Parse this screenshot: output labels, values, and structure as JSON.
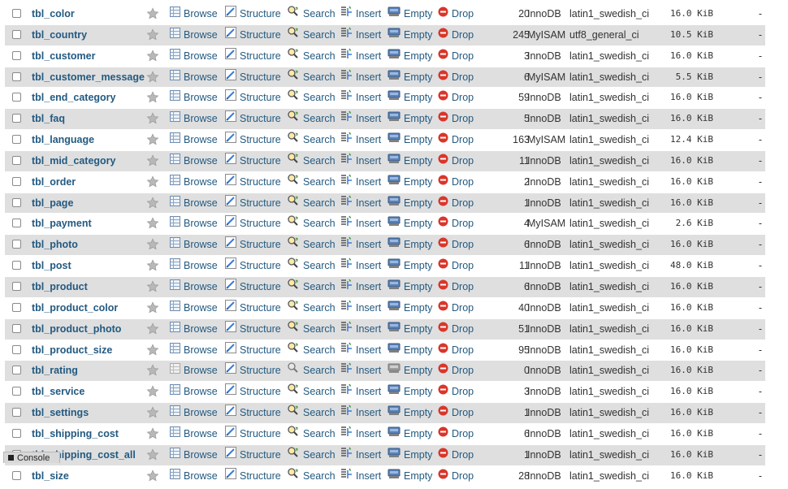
{
  "actions": {
    "browse": "Browse",
    "structure": "Structure",
    "search": "Search",
    "insert": "Insert",
    "empty": "Empty",
    "drop": "Drop"
  },
  "overhead_placeholder": "-",
  "console_label": "Console",
  "colors": {
    "link": "#235a81",
    "row_alt": "#dfdfdf",
    "drop_red": "#d9362b"
  },
  "tables": [
    {
      "name": "tbl_color",
      "rows": "20",
      "engine": "InnoDB",
      "collation": "latin1_swedish_ci",
      "size": "16.0 KiB"
    },
    {
      "name": "tbl_country",
      "rows": "245",
      "engine": "MyISAM",
      "collation": "utf8_general_ci",
      "size": "10.5 KiB"
    },
    {
      "name": "tbl_customer",
      "rows": "3",
      "engine": "InnoDB",
      "collation": "latin1_swedish_ci",
      "size": "16.0 KiB"
    },
    {
      "name": "tbl_customer_message",
      "rows": "6",
      "engine": "MyISAM",
      "collation": "latin1_swedish_ci",
      "size": "5.5 KiB"
    },
    {
      "name": "tbl_end_category",
      "rows": "59",
      "engine": "InnoDB",
      "collation": "latin1_swedish_ci",
      "size": "16.0 KiB"
    },
    {
      "name": "tbl_faq",
      "rows": "5",
      "engine": "InnoDB",
      "collation": "latin1_swedish_ci",
      "size": "16.0 KiB"
    },
    {
      "name": "tbl_language",
      "rows": "163",
      "engine": "MyISAM",
      "collation": "latin1_swedish_ci",
      "size": "12.4 KiB"
    },
    {
      "name": "tbl_mid_category",
      "rows": "11",
      "engine": "InnoDB",
      "collation": "latin1_swedish_ci",
      "size": "16.0 KiB"
    },
    {
      "name": "tbl_order",
      "rows": "2",
      "engine": "InnoDB",
      "collation": "latin1_swedish_ci",
      "size": "16.0 KiB"
    },
    {
      "name": "tbl_page",
      "rows": "1",
      "engine": "InnoDB",
      "collation": "latin1_swedish_ci",
      "size": "16.0 KiB"
    },
    {
      "name": "tbl_payment",
      "rows": "4",
      "engine": "MyISAM",
      "collation": "latin1_swedish_ci",
      "size": "2.6 KiB"
    },
    {
      "name": "tbl_photo",
      "rows": "6",
      "engine": "InnoDB",
      "collation": "latin1_swedish_ci",
      "size": "16.0 KiB"
    },
    {
      "name": "tbl_post",
      "rows": "11",
      "engine": "InnoDB",
      "collation": "latin1_swedish_ci",
      "size": "48.0 KiB"
    },
    {
      "name": "tbl_product",
      "rows": "6",
      "engine": "InnoDB",
      "collation": "latin1_swedish_ci",
      "size": "16.0 KiB"
    },
    {
      "name": "tbl_product_color",
      "rows": "40",
      "engine": "InnoDB",
      "collation": "latin1_swedish_ci",
      "size": "16.0 KiB"
    },
    {
      "name": "tbl_product_photo",
      "rows": "51",
      "engine": "InnoDB",
      "collation": "latin1_swedish_ci",
      "size": "16.0 KiB"
    },
    {
      "name": "tbl_product_size",
      "rows": "95",
      "engine": "InnoDB",
      "collation": "latin1_swedish_ci",
      "size": "16.0 KiB"
    },
    {
      "name": "tbl_rating",
      "rows": "0",
      "engine": "InnoDB",
      "collation": "latin1_swedish_ci",
      "size": "16.0 KiB",
      "empty_table": true
    },
    {
      "name": "tbl_service",
      "rows": "3",
      "engine": "InnoDB",
      "collation": "latin1_swedish_ci",
      "size": "16.0 KiB"
    },
    {
      "name": "tbl_settings",
      "rows": "1",
      "engine": "InnoDB",
      "collation": "latin1_swedish_ci",
      "size": "16.0 KiB"
    },
    {
      "name": "tbl_shipping_cost",
      "rows": "6",
      "engine": "InnoDB",
      "collation": "latin1_swedish_ci",
      "size": "16.0 KiB"
    },
    {
      "name": "tbl_shipping_cost_all",
      "rows": "1",
      "engine": "InnoDB",
      "collation": "latin1_swedish_ci",
      "size": "16.0 KiB"
    },
    {
      "name": "tbl_size",
      "rows": "28",
      "engine": "InnoDB",
      "collation": "latin1_swedish_ci",
      "size": "16.0 KiB"
    }
  ]
}
